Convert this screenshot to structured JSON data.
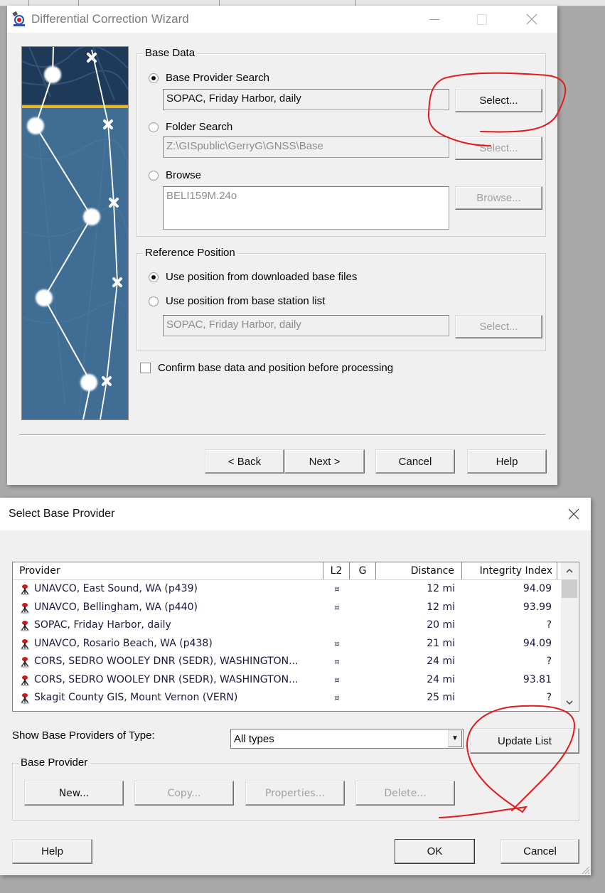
{
  "wizard": {
    "title": "Differential Correction Wizard",
    "title_icon": "gps-target-icon",
    "controls": {
      "minimize": "minimize-icon",
      "maximize": "maximize-icon",
      "close": "close-icon"
    },
    "base_data": {
      "legend": "Base Data",
      "options": [
        {
          "label": "Base Provider Search",
          "checked": true,
          "field_value": "SOPAC, Friday Harbor, daily",
          "field_enabled": true,
          "button": "Select...",
          "button_enabled": true
        },
        {
          "label": "Folder Search",
          "checked": false,
          "field_value": "Z:\\GISpublic\\GerryG\\GNSS\\Base",
          "field_enabled": false,
          "button": "Select...",
          "button_enabled": false
        },
        {
          "label": "Browse",
          "checked": false,
          "field_value": "BELI159M.24o",
          "field_enabled": false,
          "button": "Browse...",
          "button_enabled": false
        }
      ]
    },
    "reference_position": {
      "legend": "Reference Position",
      "options": [
        {
          "label": "Use position from downloaded base files",
          "checked": true
        },
        {
          "label": "Use position from base station list",
          "checked": false
        }
      ],
      "field_value": "SOPAC, Friday Harbor, daily",
      "button": "Select..."
    },
    "confirm_checkbox": {
      "label": "Confirm base data and position before processing",
      "checked": false
    },
    "buttons": {
      "back": "< Back",
      "next": "Next >",
      "cancel": "Cancel",
      "help": "Help"
    }
  },
  "select_dialog": {
    "title": "Select Base Provider",
    "close_icon": "close-icon",
    "list": {
      "columns": [
        "Provider",
        "L2",
        "G",
        "Distance",
        "Integrity Index"
      ],
      "row_icon": "base-station-tripod-icon",
      "rows": [
        {
          "provider": "UNAVCO, East Sound, WA (p439)",
          "l2": "¤",
          "g": "",
          "distance": "12 mi",
          "integrity": "94.09"
        },
        {
          "provider": "UNAVCO, Bellingham, WA (p440)",
          "l2": "¤",
          "g": "",
          "distance": "12 mi",
          "integrity": "93.99"
        },
        {
          "provider": "SOPAC, Friday Harbor, daily",
          "l2": "",
          "g": "",
          "distance": "20 mi",
          "integrity": "?"
        },
        {
          "provider": "UNAVCO, Rosario Beach, WA (p438)",
          "l2": "¤",
          "g": "",
          "distance": "21 mi",
          "integrity": "94.09"
        },
        {
          "provider": "CORS, SEDRO WOOLEY DNR (SEDR),  WASHINGTON...",
          "l2": "¤",
          "g": "",
          "distance": "24 mi",
          "integrity": "?"
        },
        {
          "provider": "CORS, SEDRO WOOLEY DNR (SEDR),  WASHINGTON...",
          "l2": "¤",
          "g": "",
          "distance": "24 mi",
          "integrity": "93.81"
        },
        {
          "provider": "Skagit County GIS, Mount Vernon (VERN)",
          "l2": "¤",
          "g": "",
          "distance": "25 mi",
          "integrity": "?"
        }
      ],
      "scroll_up": "▲",
      "scroll_down": "▼"
    },
    "filter": {
      "label": "Show Base Providers of Type:",
      "selected": "All types",
      "update_button": "Update List"
    },
    "base_provider_group": {
      "legend": "Base Provider",
      "buttons": [
        {
          "label": "New...",
          "enabled": true
        },
        {
          "label": "Copy...",
          "enabled": false
        },
        {
          "label": "Properties...",
          "enabled": false
        },
        {
          "label": "Delete...",
          "enabled": false
        }
      ]
    },
    "buttons": {
      "help": "Help",
      "ok": "OK",
      "cancel": "Cancel"
    }
  },
  "annotation_color": "#e31b1b"
}
